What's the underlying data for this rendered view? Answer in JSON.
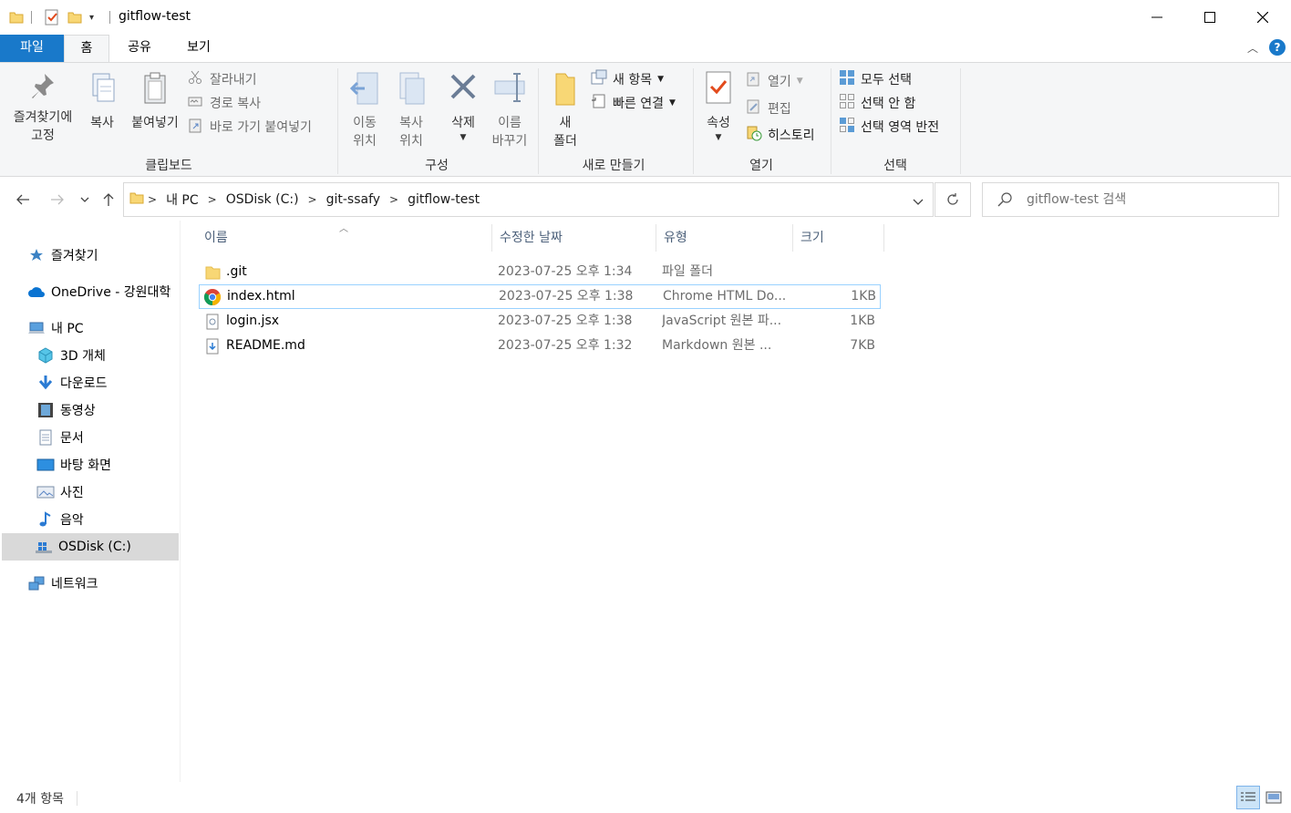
{
  "window": {
    "title": "gitflow-test",
    "minimize": "—",
    "maximize": "☐",
    "close": "✕"
  },
  "ribbon_tabs": [
    "파일",
    "홈",
    "공유",
    "보기"
  ],
  "ribbon": {
    "clipboard": {
      "pin_label": "즐겨찾기에\n고정",
      "copy_label": "복사",
      "paste_label": "붙여넣기",
      "cut_label": "잘라내기",
      "copy_path_label": "경로 복사",
      "paste_shortcut_label": "바로 가기 붙여넣기",
      "group_label": "클립보드"
    },
    "organize": {
      "move_label": "이동\n위치",
      "copyto_label": "복사\n위치",
      "delete_label": "삭제",
      "rename_label": "이름\n바꾸기",
      "group_label": "구성"
    },
    "new": {
      "new_folder_label": "새\n폴더",
      "new_item_label": "새 항목",
      "easy_access_label": "빠른 연결",
      "group_label": "새로 만들기"
    },
    "open": {
      "properties_label": "속성",
      "open_label": "열기",
      "edit_label": "편집",
      "history_label": "히스토리",
      "group_label": "열기"
    },
    "select": {
      "select_all_label": "모두 선택",
      "select_none_label": "선택 안 함",
      "invert_label": "선택 영역 반전",
      "group_label": "선택"
    }
  },
  "address": {
    "crumbs": [
      "내 PC",
      "OSDisk (C:)",
      "git-ssafy",
      "gitflow-test"
    ],
    "search_placeholder": "gitflow-test 검색"
  },
  "nav_pane": {
    "favorites": "즐겨찾기",
    "onedrive": "OneDrive - 강원대학",
    "this_pc": "내 PC",
    "items": [
      "3D 개체",
      "다운로드",
      "동영상",
      "문서",
      "바탕 화면",
      "사진",
      "음악",
      "OSDisk (C:)"
    ],
    "network": "네트워크"
  },
  "columns": {
    "name": "이름",
    "date": "수정한 날짜",
    "type": "유형",
    "size": "크기"
  },
  "files": [
    {
      "name": ".git",
      "date": "2023-07-25 오후 1:34",
      "type": "파일 폴더",
      "size": "",
      "icon": "folder-icon"
    },
    {
      "name": "index.html",
      "date": "2023-07-25 오후 1:38",
      "type": "Chrome HTML Do...",
      "size": "1KB",
      "icon": "chrome-icon"
    },
    {
      "name": "login.jsx",
      "date": "2023-07-25 오후 1:38",
      "type": "JavaScript 원본 파...",
      "size": "1KB",
      "icon": "script-file-icon"
    },
    {
      "name": "README.md",
      "date": "2023-07-25 오후 1:32",
      "type": "Markdown 원본 ...",
      "size": "7KB",
      "icon": "markdown-file-icon"
    }
  ],
  "status": {
    "count": "4개 항목"
  },
  "colors": {
    "file_tab": "#1979ca",
    "ribbon_bg": "#f5f6f7",
    "selection_border": "#99d1ff",
    "folder_yellow": "#f8d775"
  }
}
